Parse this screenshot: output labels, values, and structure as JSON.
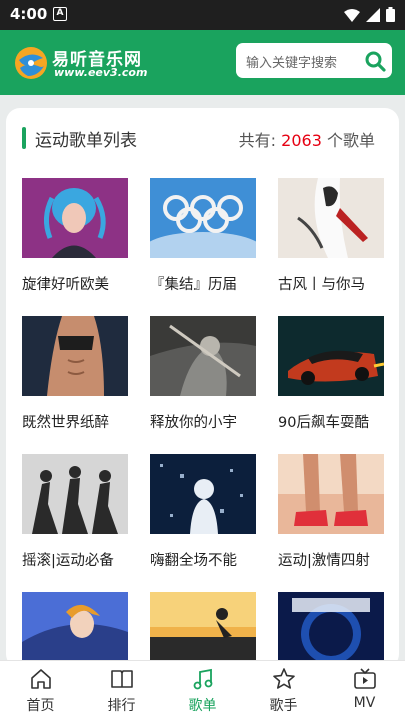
{
  "status_bar": {
    "time": "4:00",
    "notification_icon": "A"
  },
  "header": {
    "logo_name": "易听音乐网",
    "logo_url": "www.eev3.com",
    "search": {
      "placeholder": "输入关键字搜索"
    }
  },
  "list": {
    "title": "运动歌单列表",
    "count_prefix": "共有:",
    "count": "2063",
    "count_suffix": "个歌单",
    "items": [
      {
        "caption": "旋律好听欧美"
      },
      {
        "caption": "『集结』历届"
      },
      {
        "caption": "古风丨与你马"
      },
      {
        "caption": "既然世界纸醉"
      },
      {
        "caption": "释放你的小宇"
      },
      {
        "caption": "90后飙车耍酷"
      },
      {
        "caption": "摇滚|运动必备"
      },
      {
        "caption": "嗨翻全场不能"
      },
      {
        "caption": "运动|激情四射"
      },
      {
        "caption": ""
      },
      {
        "caption": ""
      },
      {
        "caption": ""
      }
    ]
  },
  "nav": {
    "items": [
      {
        "label": "首页",
        "icon": "home-icon"
      },
      {
        "label": "排行",
        "icon": "book-icon"
      },
      {
        "label": "歌单",
        "icon": "music-note-icon"
      },
      {
        "label": "歌手",
        "icon": "star-icon"
      },
      {
        "label": "MV",
        "icon": "tv-icon"
      }
    ],
    "active_index": 2
  },
  "colors": {
    "brand": "#1aa35e",
    "count": "#e60012"
  }
}
